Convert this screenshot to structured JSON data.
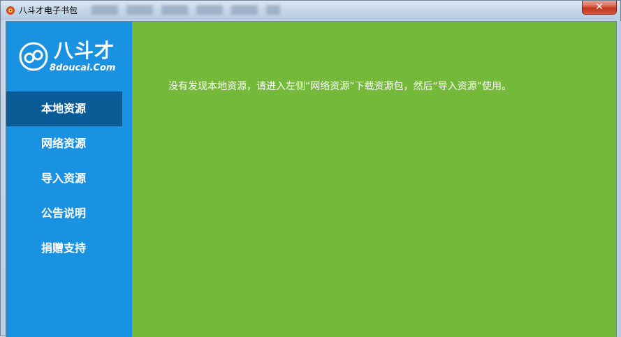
{
  "window": {
    "title": "八斗才电子书包",
    "close_label": "✕"
  },
  "logo": {
    "name_cn": "八斗才",
    "site": "8doucai.Com"
  },
  "sidebar": {
    "items": [
      {
        "label": "本地资源",
        "active": true
      },
      {
        "label": "网络资源",
        "active": false
      },
      {
        "label": "导入资源",
        "active": false
      },
      {
        "label": "公告说明",
        "active": false
      },
      {
        "label": "捐赠支持",
        "active": false
      }
    ]
  },
  "main": {
    "message": "没有发现本地资源，请进入左侧“网络资源”下载资源包，然后“导入资源”使用。"
  },
  "colors": {
    "sidebar": "#1a92e2",
    "sidebar_active": "#0a5b96",
    "content": "#74b93a",
    "logo_accent": "#f28b1e"
  }
}
